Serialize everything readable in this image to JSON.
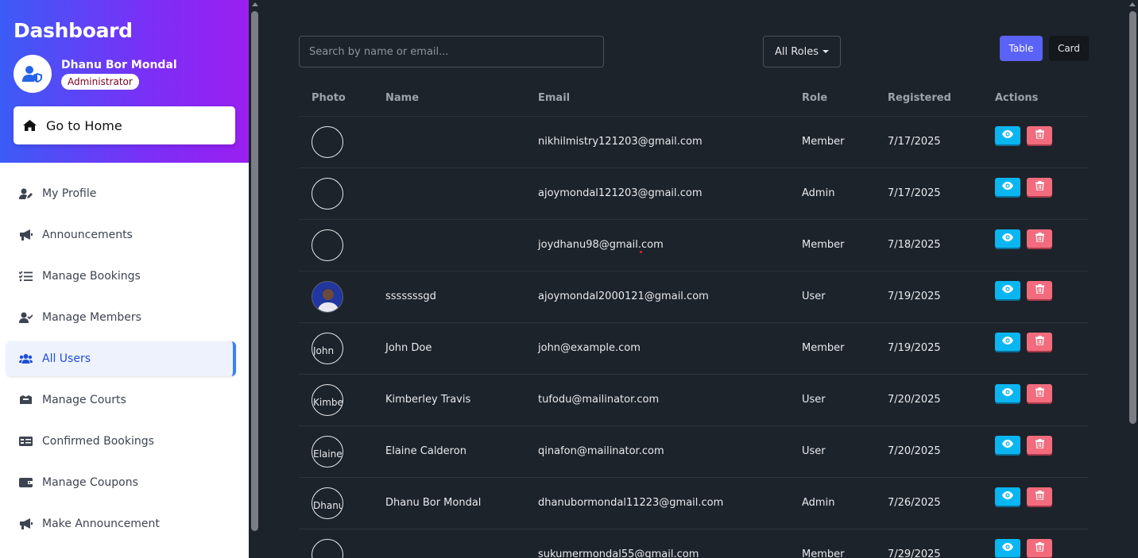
{
  "sidebar": {
    "title": "Dashboard",
    "user_name": "Dhanu Bor Mondal",
    "user_role": "Administrator",
    "home_label": "Go to Home",
    "items": [
      {
        "label": "My Profile",
        "icon": "user-pen-icon"
      },
      {
        "label": "Announcements",
        "icon": "megaphone-icon"
      },
      {
        "label": "Manage Bookings",
        "icon": "list-check-icon"
      },
      {
        "label": "Manage Members",
        "icon": "user-check-icon"
      },
      {
        "label": "All Users",
        "icon": "users-icon",
        "active": true
      },
      {
        "label": "Manage Courts",
        "icon": "box-icon"
      },
      {
        "label": "Confirmed Bookings",
        "icon": "id-card-icon"
      },
      {
        "label": "Manage Coupons",
        "icon": "wallet-icon"
      },
      {
        "label": "Make Announcement",
        "icon": "megaphone-icon"
      }
    ]
  },
  "toolbar": {
    "search_placeholder": "Search by name or email...",
    "role_filter": "All Roles",
    "view_table": "Table",
    "view_card": "Card"
  },
  "table": {
    "headers": [
      "Photo",
      "Name",
      "Email",
      "Role",
      "Registered",
      "Actions"
    ],
    "rows": [
      {
        "photo_alt": "",
        "name": "",
        "email": "nikhilmistry121203@gmail.com",
        "role": "Member",
        "registered": "7/17/2025"
      },
      {
        "photo_alt": "",
        "name": "",
        "email": "ajoymondal121203@gmail.com",
        "role": "Admin",
        "registered": "7/17/2025"
      },
      {
        "photo_alt": "",
        "name": "",
        "email": "joydhanu98@gmail.com",
        "role": "Member",
        "registered": "7/18/2025"
      },
      {
        "photo_alt": "",
        "photo_real": true,
        "name": "sssssssgd",
        "email": "ajoymondal2000121@gmail.com",
        "role": "User",
        "registered": "7/19/2025"
      },
      {
        "photo_alt": "John",
        "name": "John Doe",
        "email": "john@example.com",
        "role": "Member",
        "registered": "7/19/2025"
      },
      {
        "photo_alt": "Kimbe",
        "name": "Kimberley Travis",
        "email": "tufodu@mailinator.com",
        "role": "User",
        "registered": "7/20/2025"
      },
      {
        "photo_alt": "Elaine",
        "name": "Elaine Calderon",
        "email": "qinafon@mailinator.com",
        "role": "User",
        "registered": "7/20/2025"
      },
      {
        "photo_alt": "Dhanu",
        "name": "Dhanu Bor Mondal",
        "email": "dhanubormondal11223@gmail.com",
        "role": "Admin",
        "registered": "7/26/2025"
      },
      {
        "photo_alt": "",
        "name": "",
        "email": "sukumermondal55@gmail.com",
        "role": "Member",
        "registered": "7/29/2025"
      }
    ]
  },
  "colors": {
    "sidebar_gradient_start": "#3b5cf6",
    "sidebar_gradient_end": "#9b1ff0",
    "main_bg": "#1d232a",
    "view_button": "#0ab6f2",
    "delete_button": "#f26c7e",
    "table_toggle_active": "#5b62f6"
  }
}
